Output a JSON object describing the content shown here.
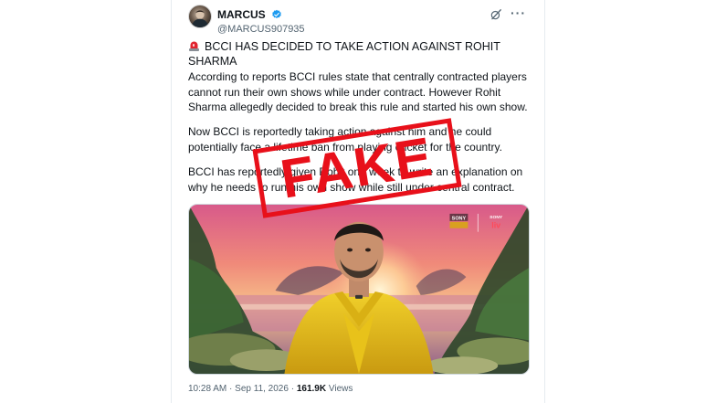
{
  "tweet": {
    "display_name": "MARCUS",
    "handle": "@MARCUS907935",
    "headline": "BCCI HAS DECIDED TO TAKE ACTION AGAINST ROHIT SHARMA",
    "paragraphs": [
      "According to reports BCCI rules state that centrally contracted players cannot run their own shows while under contract. However Rohit Sharma allegedly decided to break this rule and started his own show.",
      "Now BCCI is reportedly taking action against him and he could potentially face a lifetime ban from playing cricket for the country.",
      "BCCI has reportedly given Rohit one week to write an explanation on why he needs to run his own show while still under central contract."
    ],
    "time": "10:28 AM",
    "date": "Sep 11, 2026",
    "separator": "·",
    "views_count": "161.9K",
    "views_label": "Views"
  },
  "media": {
    "logo_sony_top": "SONY",
    "logo_sony_right": "SONY",
    "logo_liv": "liv"
  },
  "stamp": {
    "label": "FAKE"
  },
  "colors": {
    "verified_blue": "#1d9bf0",
    "stamp_red": "#e8101a",
    "jacket_yellow": "#e8c21a"
  },
  "icons": [
    "verified-badge-icon",
    "grok-icon",
    "more-options-icon",
    "siren-emoji-icon"
  ]
}
